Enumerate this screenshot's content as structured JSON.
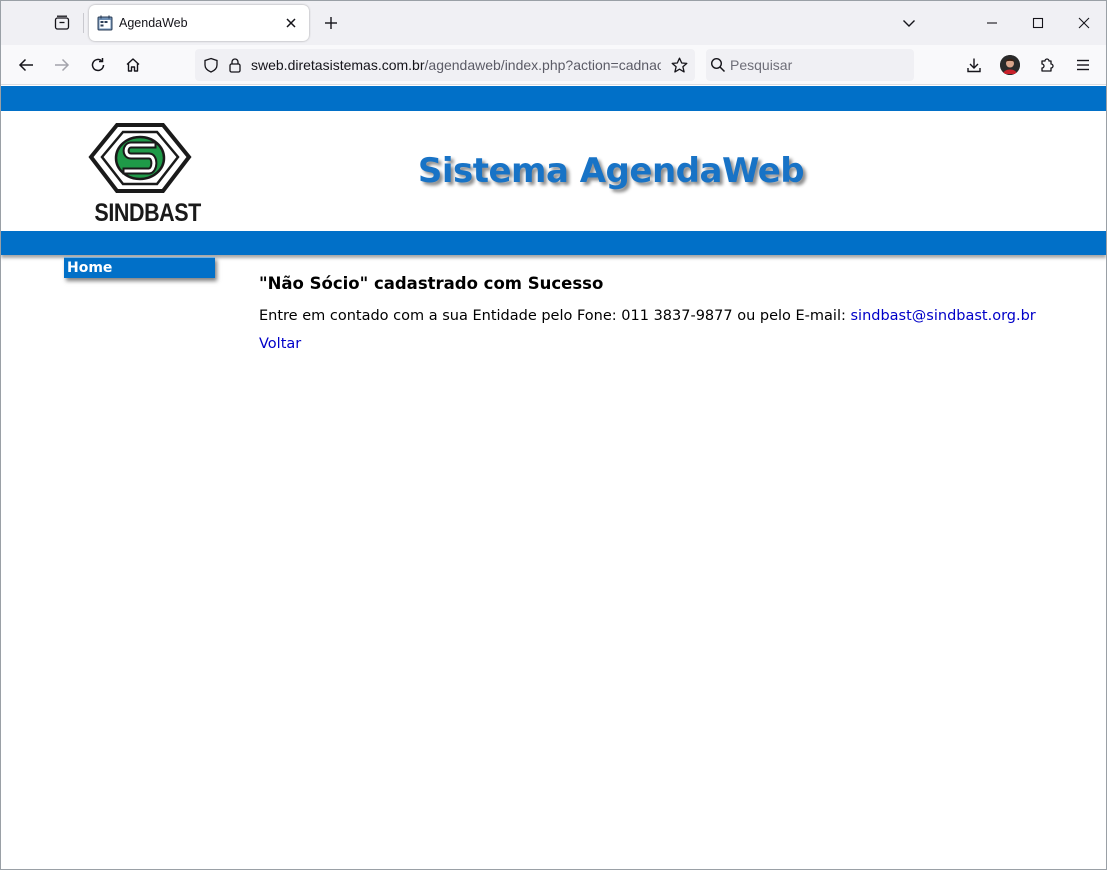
{
  "browser": {
    "tab_title": "AgendaWeb",
    "url_host": "sweb.diretasistemas.com.br",
    "url_path": "/agendaweb/index.php?action=cadnaosocio",
    "search_placeholder": "Pesquisar"
  },
  "colors": {
    "brand_blue": "#0170c8",
    "title_blue": "#1873c6",
    "link_blue": "#0000c8",
    "logo_green": "#1f9a48"
  },
  "header": {
    "logo_text": "SINDBAST",
    "site_title": "Sistema AgendaWeb"
  },
  "menu": {
    "home_label": "Home"
  },
  "content": {
    "title": "\"Não Sócio\" cadastrado com Sucesso",
    "contact_text": "Entre em contado com a sua Entidade pelo Fone: 011 3837-9877 ou pelo E-mail: ",
    "email": "sindbast@sindbast.org.br",
    "back_label": "Voltar"
  }
}
